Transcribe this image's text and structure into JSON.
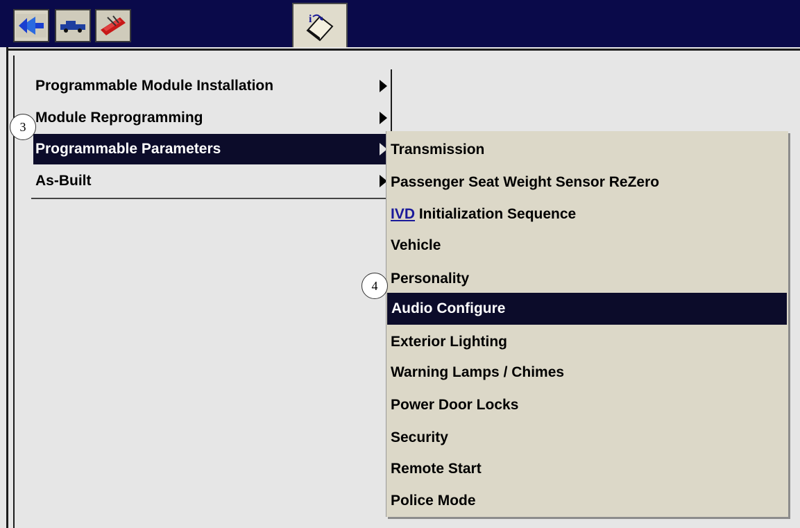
{
  "toolbar": {
    "tabs": [
      {
        "icon": "back-arrow-icon"
      },
      {
        "icon": "vehicle-icon"
      },
      {
        "icon": "toolbox-icon"
      },
      {
        "icon": "info-book-icon"
      }
    ]
  },
  "main_menu": {
    "items": [
      {
        "label": "Programmable Module Installation",
        "selected": false
      },
      {
        "label": "Module Reprogramming",
        "selected": false
      },
      {
        "label": "Programmable Parameters",
        "selected": true
      },
      {
        "label": "As-Built",
        "selected": false
      }
    ]
  },
  "submenu": {
    "items": [
      {
        "label": "Transmission"
      },
      {
        "label": "Passenger Seat Weight Sensor ReZero"
      },
      {
        "label_link": "IVD",
        "label": " Initialization Sequence"
      },
      {
        "label": "Vehicle"
      },
      {
        "label": "Personality"
      },
      {
        "label": "Audio Configure",
        "selected": true
      },
      {
        "label": "Exterior Lighting"
      },
      {
        "label": "Warning Lamps / Chimes"
      },
      {
        "label": "Power Door Locks"
      },
      {
        "label": "Security"
      },
      {
        "label": "Remote Start"
      },
      {
        "label": "Police Mode"
      }
    ]
  },
  "callouts": [
    "3",
    "4"
  ],
  "colors": {
    "toolbar_bg": "#0a0a4a",
    "selection_bg": "#0c0c2a",
    "submenu_bg": "#dcd8c8",
    "content_bg": "#e6e6e6"
  }
}
